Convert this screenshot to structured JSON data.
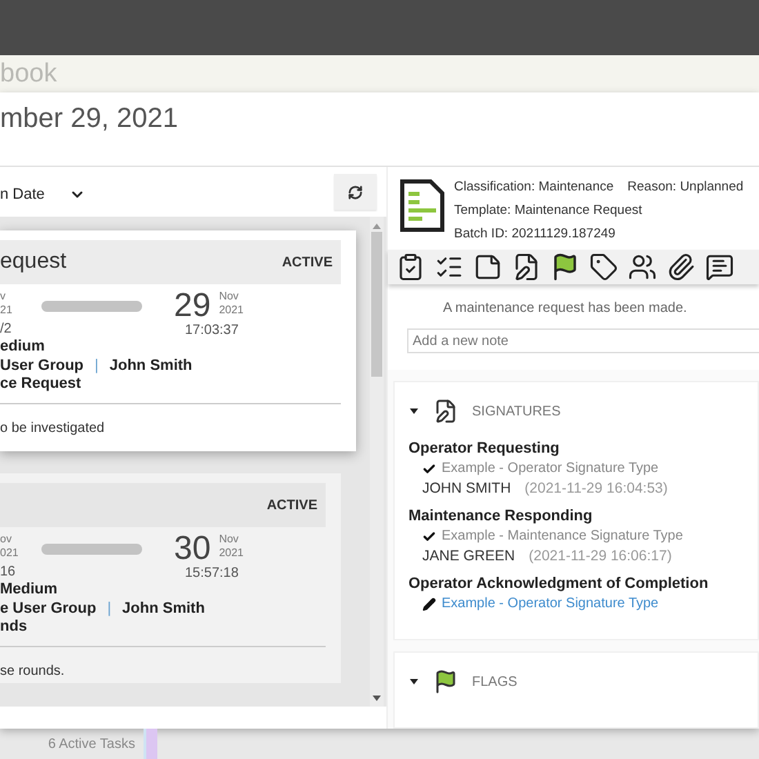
{
  "app_title": "book",
  "page_title": "mber 29, 2021",
  "sort_select": {
    "value": "n Date"
  },
  "tasks": [
    {
      "title": "equest",
      "status": "ACTIVE",
      "selected": true,
      "start_month": "v",
      "start_year": "21",
      "start_time": "/2",
      "end_day": "29",
      "end_month": "Nov",
      "end_year": "2021",
      "end_time": "17:03:37",
      "priority": "edium",
      "group": "User Group",
      "separator": "|",
      "assignee": "John Smith",
      "type": "ce Request",
      "description": "o be investigated"
    },
    {
      "status": "ACTIVE",
      "selected": false,
      "start_month": "ov",
      "start_year": "021",
      "start_time": "16",
      "end_day": "30",
      "end_month": "Nov",
      "end_year": "2021",
      "end_time": "15:57:18",
      "priority": "Medium",
      "group": "e User Group",
      "separator": "|",
      "assignee": "John Smith",
      "type": "nds",
      "description": "se rounds."
    }
  ],
  "detail": {
    "fields": [
      {
        "label": "Classification:",
        "value": "Maintenance"
      },
      {
        "label": "Reason:",
        "value": "Unplanned"
      },
      {
        "label": "Template:",
        "value": "Maintenance Request"
      },
      {
        "label": "Batch ID:",
        "value": "20211129.187249"
      }
    ],
    "note": "A maintenance request has been made.",
    "note_input": {
      "placeholder": "Add a new note"
    },
    "sections": [
      {
        "kind": "signatures",
        "title": "SIGNATURES",
        "expanded": true,
        "signatures": [
          {
            "role": "Operator Requesting",
            "type": "Example - Operator Signature Type",
            "signed": true,
            "signer": "JOHN SMITH",
            "time": "(2021-11-29 16:04:53)"
          },
          {
            "role": "Maintenance Responding",
            "type": "Example - Maintenance Signature Type",
            "signed": true,
            "signer": "JANE GREEN",
            "time": "(2021-11-29 16:06:17)"
          },
          {
            "role": "Operator Acknowledgment of Completion",
            "type": "Example - Operator Signature Type",
            "signed": false
          }
        ]
      },
      {
        "kind": "flags",
        "title": "FLAGS",
        "expanded": true
      }
    ]
  },
  "footer": {
    "active_tasks": "6 Active Tasks"
  }
}
